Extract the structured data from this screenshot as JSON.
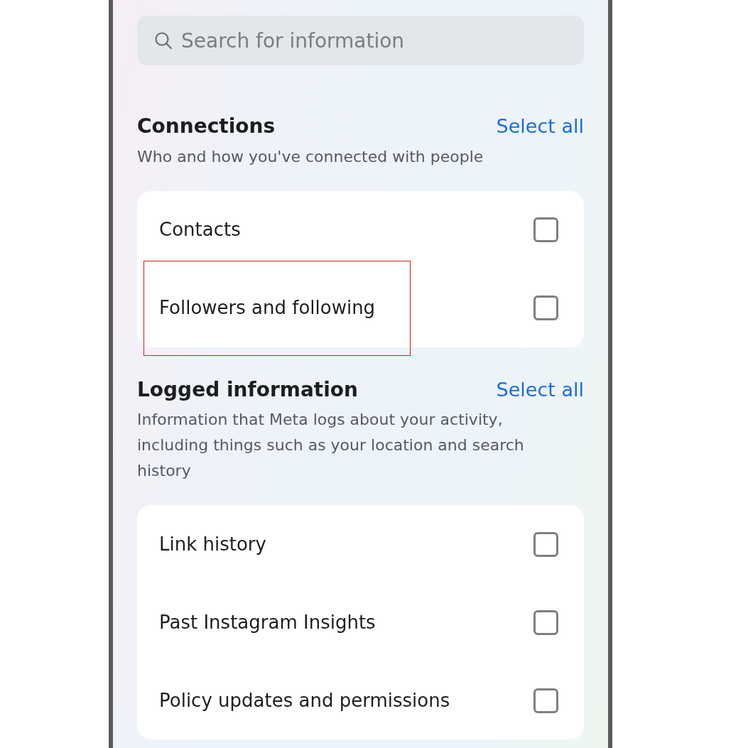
{
  "search": {
    "placeholder": "Search for information"
  },
  "sections": [
    {
      "title": "Connections",
      "action": "Select all",
      "description": "Who and how you've connected with people",
      "items": [
        {
          "label": "Contacts",
          "checked": false,
          "highlighted": false
        },
        {
          "label": "Followers and following",
          "checked": false,
          "highlighted": true
        }
      ]
    },
    {
      "title": "Logged information",
      "action": "Select all",
      "description": "Information that Meta logs about your activity, including things such as your location and search history",
      "items": [
        {
          "label": "Link history",
          "checked": false,
          "highlighted": false
        },
        {
          "label": "Past Instagram Insights",
          "checked": false,
          "highlighted": false
        },
        {
          "label": "Policy updates and permissions",
          "checked": false,
          "highlighted": false
        }
      ]
    }
  ]
}
